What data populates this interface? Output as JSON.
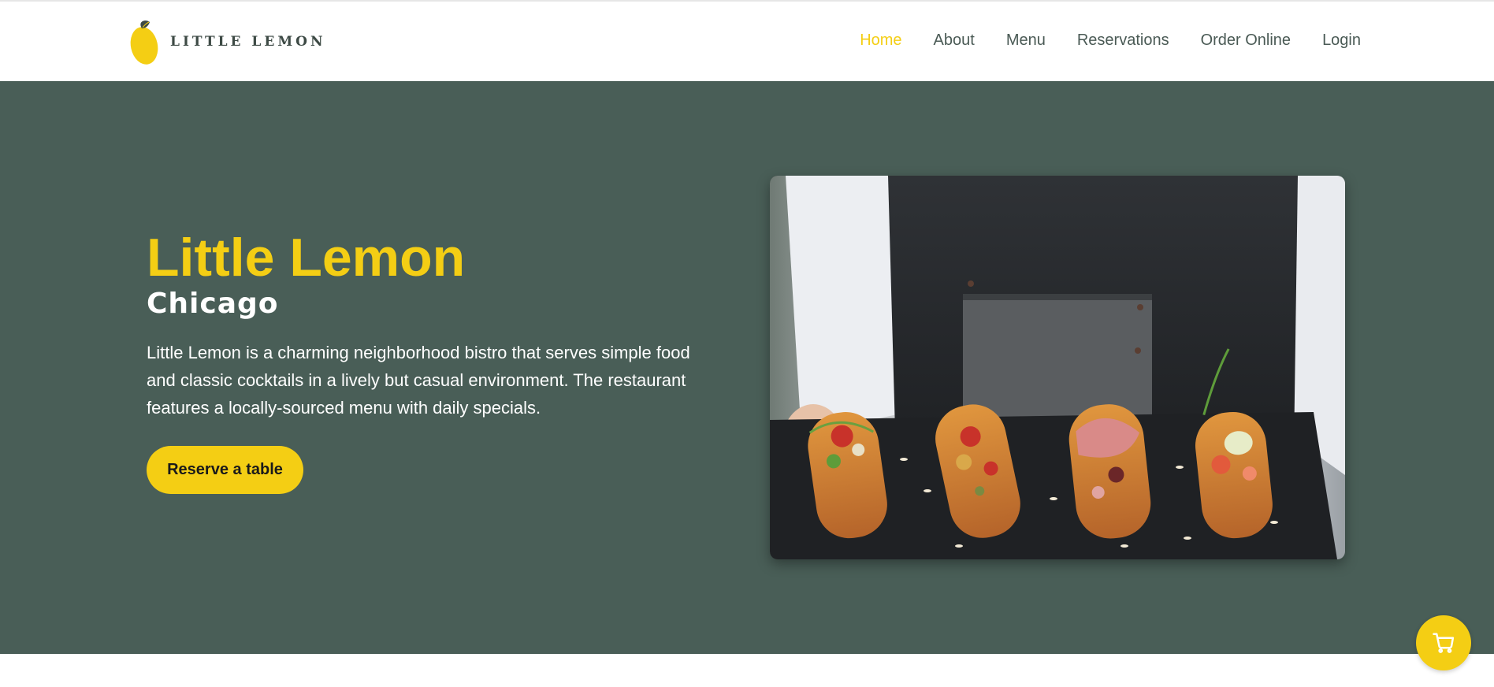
{
  "brand": {
    "logo_text": "LITTLE LEMON",
    "logo_icon": "lemon-icon"
  },
  "nav": {
    "items": [
      {
        "label": "Home",
        "active": true
      },
      {
        "label": "About",
        "active": false
      },
      {
        "label": "Menu",
        "active": false
      },
      {
        "label": "Reservations",
        "active": false
      },
      {
        "label": "Order Online",
        "active": false
      },
      {
        "label": "Login",
        "active": false
      }
    ]
  },
  "hero": {
    "title": "Little Lemon",
    "subtitle": "Chicago",
    "description": "Little Lemon is a charming neighborhood bistro that serves simple food and classic cocktails in a lively but casual environment. The restaurant features a locally-sourced menu with daily specials.",
    "cta_label": "Reserve a table",
    "image_subject": "server holding a slate board of four bruschetta-topped pastries"
  },
  "cart": {
    "icon": "cart-icon"
  },
  "colors": {
    "primary_green": "#495e57",
    "primary_yellow": "#f4ce14",
    "nav_text": "#4a5a55",
    "white": "#ffffff"
  }
}
